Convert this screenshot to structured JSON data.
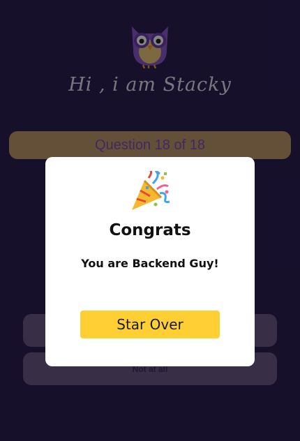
{
  "header": {
    "greeting": "Hi , i am Stacky",
    "mascot_icon": "owl-icon"
  },
  "quiz": {
    "question_counter": "Question 18 of 18",
    "answers": [
      {
        "label": ""
      },
      {
        "label": "Not at all"
      }
    ]
  },
  "modal": {
    "icon": "party-popper-icon",
    "title": "Congrats",
    "message": "You are Backend Guy!",
    "restart_label": "Star Over"
  },
  "colors": {
    "background": "#2c1f54",
    "question_bar": "#c09a6d",
    "question_text": "#7b4fbc",
    "answer_bg": "#6b5b86",
    "button": "#ffcf33"
  }
}
